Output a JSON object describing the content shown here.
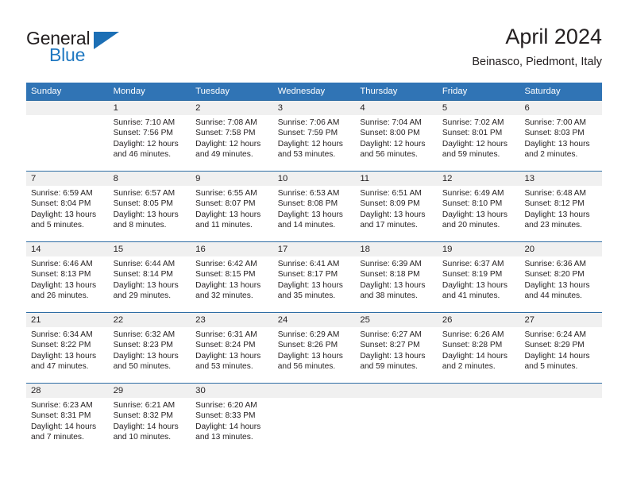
{
  "brand": {
    "name_top": "General",
    "name_bottom": "Blue",
    "accent_color": "#1f78c1"
  },
  "header": {
    "title": "April 2024",
    "subtitle": "Beinasco, Piedmont, Italy"
  },
  "theme": {
    "header_row_bg": "#3074b5",
    "date_band_bg": "#f0f0f0",
    "separator_color": "#2e6da4",
    "text_color": "#231f20"
  },
  "day_headers": [
    "Sunday",
    "Monday",
    "Tuesday",
    "Wednesday",
    "Thursday",
    "Friday",
    "Saturday"
  ],
  "weeks": [
    {
      "dates": [
        "",
        "1",
        "2",
        "3",
        "4",
        "5",
        "6"
      ],
      "cells": [
        {
          "sunrise": "",
          "sunset": "",
          "daylight": ""
        },
        {
          "sunrise": "Sunrise: 7:10 AM",
          "sunset": "Sunset: 7:56 PM",
          "daylight": "Daylight: 12 hours and 46 minutes."
        },
        {
          "sunrise": "Sunrise: 7:08 AM",
          "sunset": "Sunset: 7:58 PM",
          "daylight": "Daylight: 12 hours and 49 minutes."
        },
        {
          "sunrise": "Sunrise: 7:06 AM",
          "sunset": "Sunset: 7:59 PM",
          "daylight": "Daylight: 12 hours and 53 minutes."
        },
        {
          "sunrise": "Sunrise: 7:04 AM",
          "sunset": "Sunset: 8:00 PM",
          "daylight": "Daylight: 12 hours and 56 minutes."
        },
        {
          "sunrise": "Sunrise: 7:02 AM",
          "sunset": "Sunset: 8:01 PM",
          "daylight": "Daylight: 12 hours and 59 minutes."
        },
        {
          "sunrise": "Sunrise: 7:00 AM",
          "sunset": "Sunset: 8:03 PM",
          "daylight": "Daylight: 13 hours and 2 minutes."
        }
      ]
    },
    {
      "dates": [
        "7",
        "8",
        "9",
        "10",
        "11",
        "12",
        "13"
      ],
      "cells": [
        {
          "sunrise": "Sunrise: 6:59 AM",
          "sunset": "Sunset: 8:04 PM",
          "daylight": "Daylight: 13 hours and 5 minutes."
        },
        {
          "sunrise": "Sunrise: 6:57 AM",
          "sunset": "Sunset: 8:05 PM",
          "daylight": "Daylight: 13 hours and 8 minutes."
        },
        {
          "sunrise": "Sunrise: 6:55 AM",
          "sunset": "Sunset: 8:07 PM",
          "daylight": "Daylight: 13 hours and 11 minutes."
        },
        {
          "sunrise": "Sunrise: 6:53 AM",
          "sunset": "Sunset: 8:08 PM",
          "daylight": "Daylight: 13 hours and 14 minutes."
        },
        {
          "sunrise": "Sunrise: 6:51 AM",
          "sunset": "Sunset: 8:09 PM",
          "daylight": "Daylight: 13 hours and 17 minutes."
        },
        {
          "sunrise": "Sunrise: 6:49 AM",
          "sunset": "Sunset: 8:10 PM",
          "daylight": "Daylight: 13 hours and 20 minutes."
        },
        {
          "sunrise": "Sunrise: 6:48 AM",
          "sunset": "Sunset: 8:12 PM",
          "daylight": "Daylight: 13 hours and 23 minutes."
        }
      ]
    },
    {
      "dates": [
        "14",
        "15",
        "16",
        "17",
        "18",
        "19",
        "20"
      ],
      "cells": [
        {
          "sunrise": "Sunrise: 6:46 AM",
          "sunset": "Sunset: 8:13 PM",
          "daylight": "Daylight: 13 hours and 26 minutes."
        },
        {
          "sunrise": "Sunrise: 6:44 AM",
          "sunset": "Sunset: 8:14 PM",
          "daylight": "Daylight: 13 hours and 29 minutes."
        },
        {
          "sunrise": "Sunrise: 6:42 AM",
          "sunset": "Sunset: 8:15 PM",
          "daylight": "Daylight: 13 hours and 32 minutes."
        },
        {
          "sunrise": "Sunrise: 6:41 AM",
          "sunset": "Sunset: 8:17 PM",
          "daylight": "Daylight: 13 hours and 35 minutes."
        },
        {
          "sunrise": "Sunrise: 6:39 AM",
          "sunset": "Sunset: 8:18 PM",
          "daylight": "Daylight: 13 hours and 38 minutes."
        },
        {
          "sunrise": "Sunrise: 6:37 AM",
          "sunset": "Sunset: 8:19 PM",
          "daylight": "Daylight: 13 hours and 41 minutes."
        },
        {
          "sunrise": "Sunrise: 6:36 AM",
          "sunset": "Sunset: 8:20 PM",
          "daylight": "Daylight: 13 hours and 44 minutes."
        }
      ]
    },
    {
      "dates": [
        "21",
        "22",
        "23",
        "24",
        "25",
        "26",
        "27"
      ],
      "cells": [
        {
          "sunrise": "Sunrise: 6:34 AM",
          "sunset": "Sunset: 8:22 PM",
          "daylight": "Daylight: 13 hours and 47 minutes."
        },
        {
          "sunrise": "Sunrise: 6:32 AM",
          "sunset": "Sunset: 8:23 PM",
          "daylight": "Daylight: 13 hours and 50 minutes."
        },
        {
          "sunrise": "Sunrise: 6:31 AM",
          "sunset": "Sunset: 8:24 PM",
          "daylight": "Daylight: 13 hours and 53 minutes."
        },
        {
          "sunrise": "Sunrise: 6:29 AM",
          "sunset": "Sunset: 8:26 PM",
          "daylight": "Daylight: 13 hours and 56 minutes."
        },
        {
          "sunrise": "Sunrise: 6:27 AM",
          "sunset": "Sunset: 8:27 PM",
          "daylight": "Daylight: 13 hours and 59 minutes."
        },
        {
          "sunrise": "Sunrise: 6:26 AM",
          "sunset": "Sunset: 8:28 PM",
          "daylight": "Daylight: 14 hours and 2 minutes."
        },
        {
          "sunrise": "Sunrise: 6:24 AM",
          "sunset": "Sunset: 8:29 PM",
          "daylight": "Daylight: 14 hours and 5 minutes."
        }
      ]
    },
    {
      "dates": [
        "28",
        "29",
        "30",
        "",
        "",
        "",
        ""
      ],
      "cells": [
        {
          "sunrise": "Sunrise: 6:23 AM",
          "sunset": "Sunset: 8:31 PM",
          "daylight": "Daylight: 14 hours and 7 minutes."
        },
        {
          "sunrise": "Sunrise: 6:21 AM",
          "sunset": "Sunset: 8:32 PM",
          "daylight": "Daylight: 14 hours and 10 minutes."
        },
        {
          "sunrise": "Sunrise: 6:20 AM",
          "sunset": "Sunset: 8:33 PM",
          "daylight": "Daylight: 14 hours and 13 minutes."
        },
        {
          "sunrise": "",
          "sunset": "",
          "daylight": ""
        },
        {
          "sunrise": "",
          "sunset": "",
          "daylight": ""
        },
        {
          "sunrise": "",
          "sunset": "",
          "daylight": ""
        },
        {
          "sunrise": "",
          "sunset": "",
          "daylight": ""
        }
      ]
    }
  ]
}
